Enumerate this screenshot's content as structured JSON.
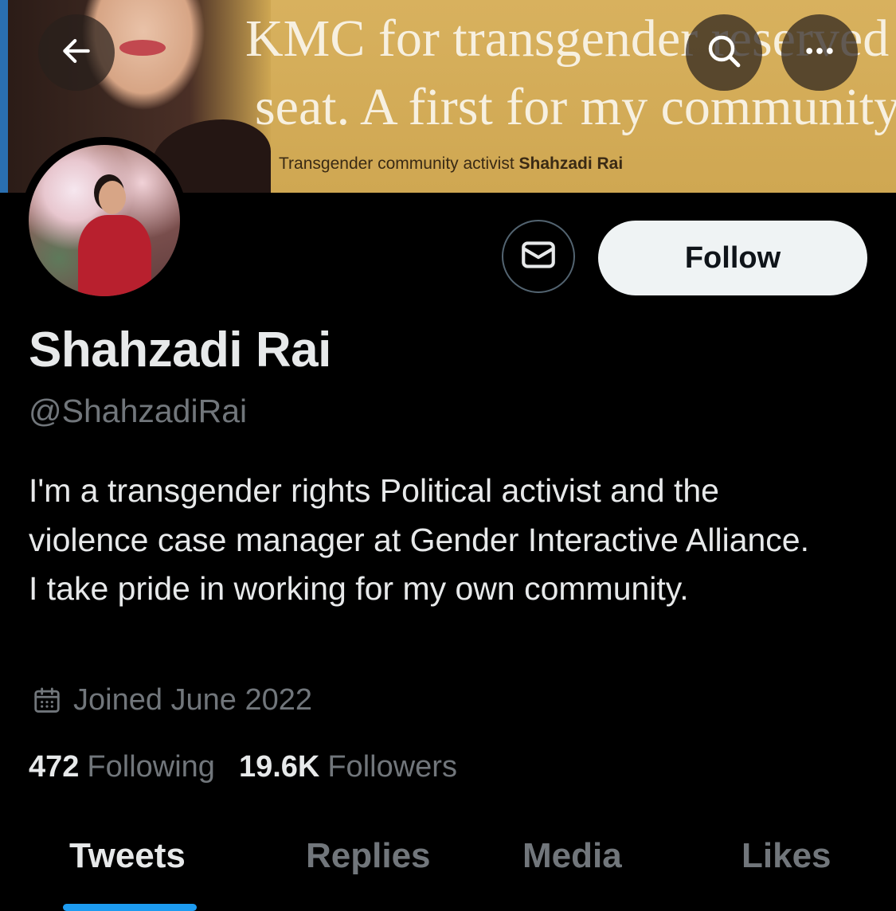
{
  "banner": {
    "headline_line1": "KMC for transgender reserved",
    "headline_line2": "seat. A first for my community",
    "caption_prefix": "Transgender community activist ",
    "caption_name": "Shahzadi Rai"
  },
  "header": {
    "back_icon": "arrow-left-icon",
    "search_icon": "search-icon",
    "more_icon": "more-horizontal-icon"
  },
  "actions": {
    "message_icon": "envelope-icon",
    "follow_label": "Follow"
  },
  "profile": {
    "display_name": "Shahzadi Rai",
    "handle": "@ShahzadiRai",
    "bio": "I'm a transgender rights Political activist and the violence case manager at Gender Interactive Alliance. I take pride in working for my own community.",
    "joined_icon": "calendar-icon",
    "joined": "Joined June 2022",
    "following_count": "472",
    "following_label": "Following",
    "followers_count": "19.6K",
    "followers_label": "Followers"
  },
  "tabs": [
    {
      "label": "Tweets",
      "active": true
    },
    {
      "label": "Replies",
      "active": false
    },
    {
      "label": "Media",
      "active": false
    },
    {
      "label": "Likes",
      "active": false
    }
  ],
  "colors": {
    "background": "#000000",
    "primary_text": "#e7e9ea",
    "secondary_text": "#71767b",
    "accent": "#1d9bf0",
    "follow_button_bg": "#eff3f4"
  }
}
